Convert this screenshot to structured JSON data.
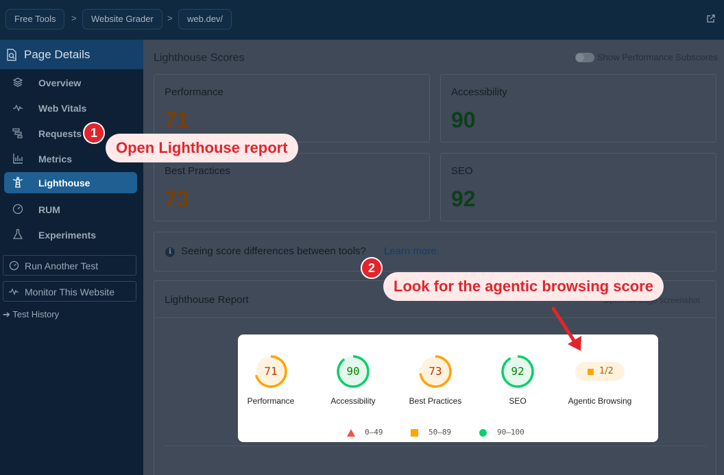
{
  "breadcrumbs": [
    "Free Tools",
    "Website Grader",
    "web.dev/"
  ],
  "sidebar": {
    "title": "Page Details",
    "items": [
      {
        "label": "Overview",
        "icon": "layers-icon"
      },
      {
        "label": "Web Vitals",
        "icon": "pulse-icon"
      },
      {
        "label": "Requests",
        "icon": "waterfall-icon"
      },
      {
        "label": "Metrics",
        "icon": "bar-chart-icon"
      },
      {
        "label": "Lighthouse",
        "icon": "lighthouse-icon",
        "active": true
      },
      {
        "label": "RUM",
        "icon": "gauge-icon"
      },
      {
        "label": "Experiments",
        "icon": "flask-icon"
      }
    ],
    "run_test": "Run Another Test",
    "monitor": "Monitor This Website",
    "history": "➔ Test History"
  },
  "main": {
    "title": "Lighthouse Scores",
    "toggle_label": "Show Performance Subscores",
    "cards": [
      {
        "title": "Performance",
        "score": "71",
        "status": "orange"
      },
      {
        "title": "Accessibility",
        "score": "90",
        "status": "green"
      },
      {
        "title": "Best Practices",
        "score": "73",
        "status": "orange"
      },
      {
        "title": "SEO",
        "score": "92",
        "status": "green"
      }
    ],
    "note_text": "Seeing score differences between tools?",
    "note_link": "Learn more.",
    "report_title": "Lighthouse Report",
    "report_link": "Open full-page screenshot"
  },
  "report_panel": {
    "gauges": [
      {
        "label": "Performance",
        "value": "71",
        "score": 0.71,
        "color": "#ffa400",
        "bg": "#fff3e0",
        "text": "#c33300"
      },
      {
        "label": "Accessibility",
        "value": "90",
        "score": 0.9,
        "color": "#0cce6b",
        "bg": "#e5f8ed",
        "text": "#008800"
      },
      {
        "label": "Best Practices",
        "value": "73",
        "score": 0.73,
        "color": "#ffa400",
        "bg": "#fff3e0",
        "text": "#c33300"
      },
      {
        "label": "SEO",
        "value": "92",
        "score": 0.92,
        "color": "#0cce6b",
        "bg": "#e5f8ed",
        "text": "#008800"
      }
    ],
    "agentic": {
      "label": "Agentic Browsing",
      "value": "1/2"
    },
    "legend": [
      "0–49",
      "50–89",
      "90–100"
    ]
  },
  "annotations": [
    {
      "number": "1",
      "text": "Open Lighthouse report"
    },
    {
      "number": "2",
      "text": "Look for the agentic browsing score"
    }
  ],
  "colors": {
    "accent_red": "#e3242b",
    "callout_bg": "#ffe9e9",
    "pass": "#0cce6b",
    "average": "#ffa400",
    "fail": "#ff4e42"
  }
}
